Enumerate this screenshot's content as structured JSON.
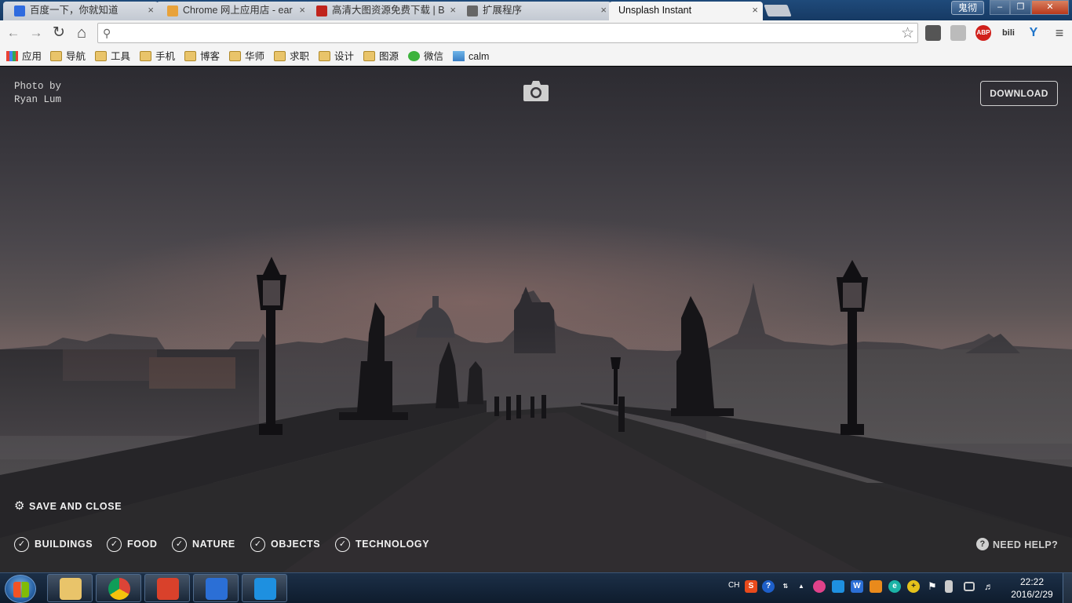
{
  "tabs": [
    {
      "title": "百度一下，你就知道",
      "close": "×",
      "icon_color": "#2f6bdf"
    },
    {
      "title": "Chrome 网上应用店 - ear",
      "close": "×",
      "icon_color": "#e8a23a"
    },
    {
      "title": "高清大图资源免费下载 | B",
      "close": "×",
      "icon_color": "#c0241c"
    },
    {
      "title": "扩展程序",
      "close": "×",
      "icon_color": "#666666"
    },
    {
      "title": "Unsplash Instant",
      "close": "×",
      "icon_color": "#ffffff"
    }
  ],
  "window": {
    "user": "鬼彻",
    "minimize": "‒",
    "maximize": "❐",
    "close": "✕"
  },
  "toolbar": {
    "back": "←",
    "forward": "→",
    "reload": "↻",
    "home": "⌂",
    "search_icon": "search-icon",
    "url": "",
    "star": "☆",
    "extensions": [
      {
        "name": "pocket-icon",
        "label": "",
        "color": "#555555"
      },
      {
        "name": "extension-gray-icon",
        "label": "",
        "color": "#bbbbbb"
      },
      {
        "name": "adblock-plus-icon",
        "label": "ABP",
        "color": "#d0201b"
      },
      {
        "name": "bilibili-icon",
        "label": "bili",
        "color": "#333333"
      },
      {
        "name": "y-extension-icon",
        "label": "Y",
        "color": "#1f74c9"
      }
    ],
    "menu": "≡"
  },
  "bookmarks": [
    {
      "label": "应用",
      "icon": "apps-icon"
    },
    {
      "label": "导航",
      "icon": "folder-icon"
    },
    {
      "label": "工具",
      "icon": "folder-icon"
    },
    {
      "label": "手机",
      "icon": "folder-icon"
    },
    {
      "label": "博客",
      "icon": "folder-icon"
    },
    {
      "label": "华师",
      "icon": "folder-icon"
    },
    {
      "label": "求职",
      "icon": "folder-icon"
    },
    {
      "label": "设计",
      "icon": "folder-icon"
    },
    {
      "label": "图源",
      "icon": "folder-icon"
    },
    {
      "label": "微信",
      "icon": "wechat-icon"
    },
    {
      "label": "calm",
      "icon": "calm-icon"
    }
  ],
  "page": {
    "credit_line1": "Photo by",
    "credit_line2": "Ryan Lum",
    "download": "DOWNLOAD",
    "save_close": "SAVE AND CLOSE",
    "categories": [
      "BUILDINGS",
      "FOOD",
      "NATURE",
      "OBJECTS",
      "TECHNOLOGY"
    ],
    "check": "✓",
    "help": "NEED HELP?",
    "help_q": "?"
  },
  "taskbar": {
    "apps": [
      {
        "name": "file-explorer-icon",
        "color": "#e9c46a"
      },
      {
        "name": "chrome-icon",
        "color": "#db4437"
      },
      {
        "name": "wunderlist-icon",
        "color": "#d9412b"
      },
      {
        "name": "word-icon",
        "color": "#2b6fd6"
      },
      {
        "name": "input-method-icon",
        "color": "#1e90e0"
      }
    ],
    "lang": "CH",
    "tray": [
      {
        "name": "sogou-icon",
        "label": "S",
        "color": "#e84a1c"
      },
      {
        "name": "help-tray-icon",
        "label": "?",
        "color": "#1e5fc9"
      },
      {
        "name": "tray-expand-icon",
        "label": "▲",
        "color": "transparent"
      },
      {
        "name": "chat-icon",
        "label": "",
        "color": "#e0428a"
      },
      {
        "name": "input-tray-icon",
        "label": "",
        "color": "#1e90e0"
      },
      {
        "name": "word-tray-icon",
        "label": "W",
        "color": "#2b6fd6"
      },
      {
        "name": "search-tray-icon",
        "label": "",
        "color": "#e98a1c"
      },
      {
        "name": "e-tray-icon",
        "label": "e",
        "color": "#1bb3a6"
      },
      {
        "name": "plus-tray-icon",
        "label": "+",
        "color": "#e5c21b"
      },
      {
        "name": "flag-icon",
        "label": "⚑",
        "color": "transparent"
      },
      {
        "name": "battery-icon",
        "label": "",
        "color": "#cccccc"
      },
      {
        "name": "network-icon",
        "label": "",
        "color": "#cccccc"
      },
      {
        "name": "volume-icon",
        "label": "🔈",
        "color": "transparent"
      }
    ],
    "time": "22:22",
    "date": "2016/2/29"
  }
}
